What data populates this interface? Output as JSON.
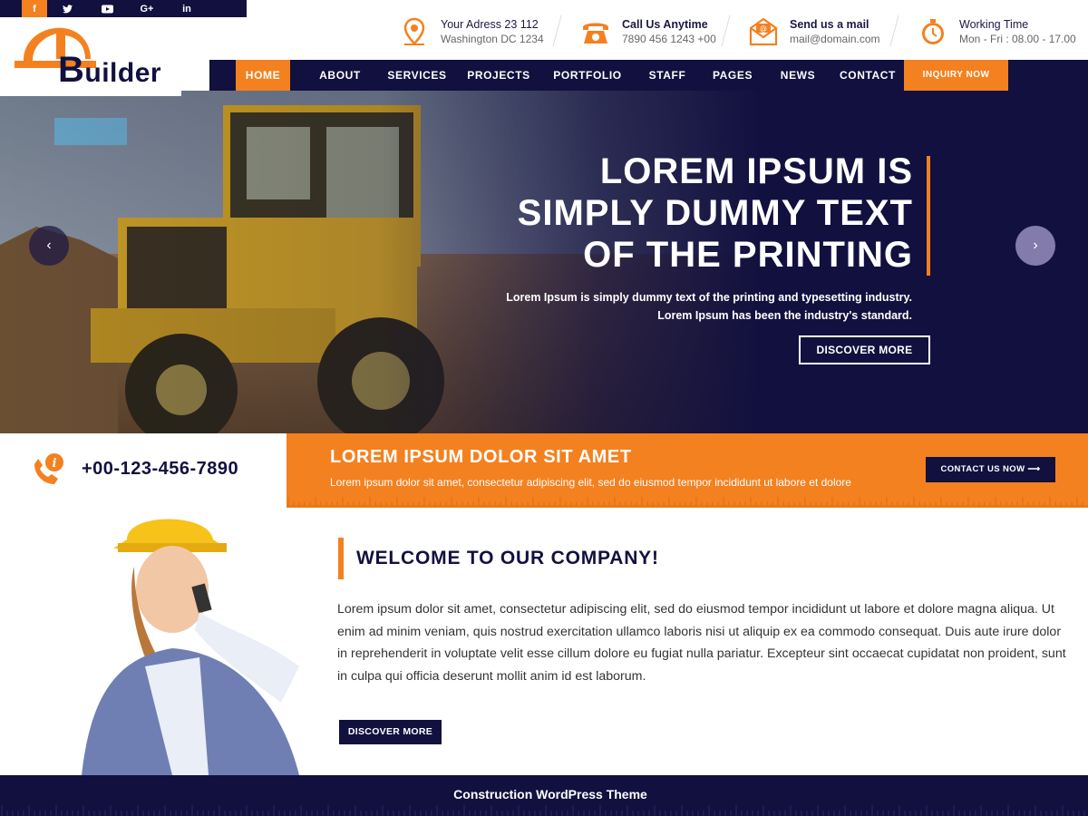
{
  "social": [
    {
      "icon": "facebook-icon",
      "glyph": "f"
    },
    {
      "icon": "twitter-icon",
      "glyph": "t"
    },
    {
      "icon": "youtube-icon",
      "glyph": "▶"
    },
    {
      "icon": "google-plus-icon",
      "glyph": "G+"
    },
    {
      "icon": "linkedin-icon",
      "glyph": "in"
    }
  ],
  "logo": {
    "big": "B",
    "rest": "uilder"
  },
  "header": {
    "address": {
      "title": "Your Adress 23 112",
      "sub": "Washington DC 1234"
    },
    "call": {
      "title": "Call Us Anytime",
      "sub": "7890 456 1243 +00"
    },
    "mail": {
      "title": "Send us a mail",
      "sub": "mail@domain.com"
    },
    "hours": {
      "title": "Working Time",
      "sub": "Mon - Fri : 08.00 - 17.00"
    }
  },
  "nav": {
    "items": [
      "HOME",
      "ABOUT",
      "SERVICES",
      "PROJECTS",
      "PORTFOLIO",
      "STAFF",
      "PAGES",
      "NEWS",
      "CONTACT"
    ],
    "inquiry": "INQUIRY NOW"
  },
  "hero": {
    "title_line1": "LOREM IPSUM IS",
    "title_line2": "SIMPLY DUMMY TEXT",
    "title_line3": "OF THE PRINTING",
    "sub_line1": "Lorem Ipsum is simply dummy text of the printing and typesetting industry.",
    "sub_line2": "Lorem Ipsum has been the industry's standard.",
    "button": "DISCOVER MORE",
    "prev": "‹",
    "next": "›"
  },
  "contact_strip": {
    "phone": "+00-123-456-7890",
    "title": "LOREM IPSUM DOLOR SIT AMET",
    "sub": "Lorem ipsum dolor sit amet, consectetur adipiscing elit, sed do eiusmod tempor incididunt ut labore et dolore",
    "button": "CONTACT US NOW"
  },
  "welcome": {
    "title": "WELCOME TO OUR COMPANY!",
    "text": "Lorem ipsum dolor sit amet, consectetur adipiscing elit, sed do eiusmod tempor incididunt ut labore et dolore magna aliqua. Ut enim ad minim veniam, quis nostrud exercitation ullamco laboris nisi ut aliquip ex ea commodo consequat. Duis aute irure dolor in reprehenderit in voluptate velit esse cillum dolore eu fugiat nulla pariatur. Excepteur sint occaecat cupidatat non proident, sunt in culpa qui officia deserunt mollit anim id est laborum.",
    "button": "DISCOVER MORE"
  },
  "footer": {
    "text": "Construction WordPress Theme"
  },
  "colors": {
    "navy": "#12103f",
    "orange": "#f38120"
  }
}
